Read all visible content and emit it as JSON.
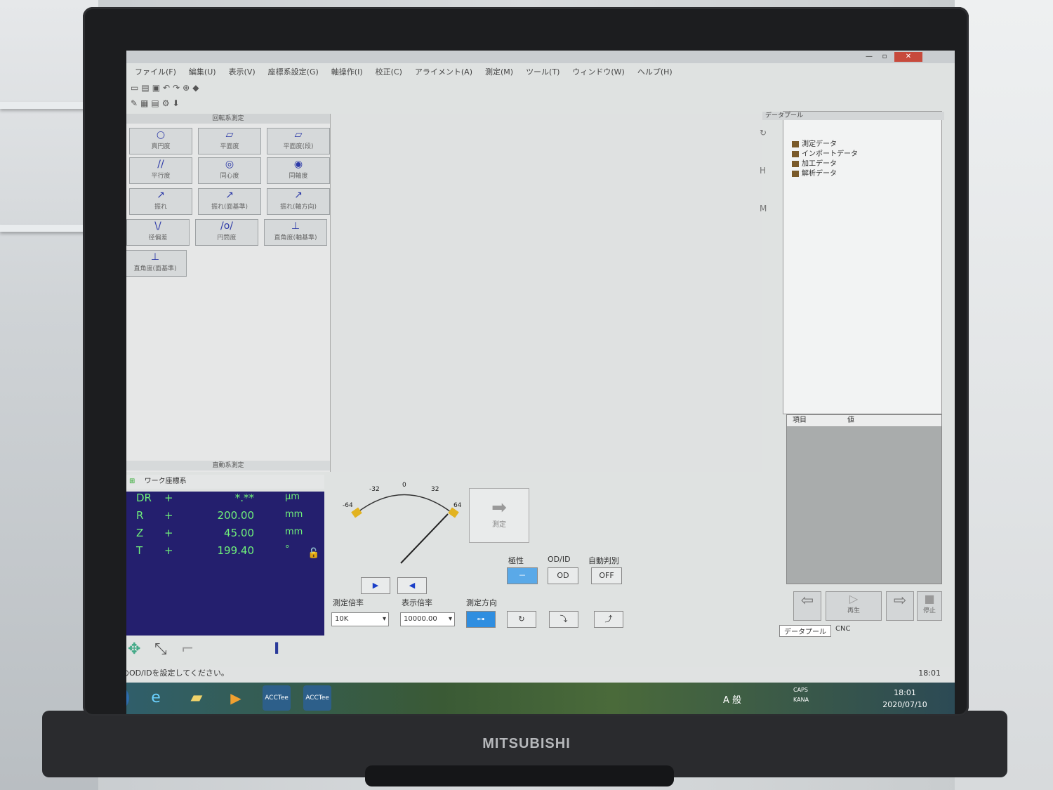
{
  "window": {
    "min": "—",
    "max": "▫",
    "close": "✕"
  },
  "menu": [
    "ファイル(F)",
    "編集(U)",
    "表示(V)",
    "座標系設定(G)",
    "軸操作(I)",
    "校正(C)",
    "アライメント(A)",
    "測定(M)",
    "ツール(T)",
    "ウィンドウ(W)",
    "ヘルプ(H)"
  ],
  "left_panel": {
    "header": "回転系測定",
    "footer": "直動系測定",
    "buttons": [
      {
        "icon": "○",
        "label": "真円度"
      },
      {
        "icon": "▱",
        "label": "平面度"
      },
      {
        "icon": "▱",
        "label": "平面度(段)"
      },
      {
        "icon": "//",
        "label": "平行度"
      },
      {
        "icon": "◎",
        "label": "同心度"
      },
      {
        "icon": "◉",
        "label": "同軸度"
      },
      {
        "icon": "↗",
        "label": "振れ"
      },
      {
        "icon": "↗",
        "label": "振れ(面基準)"
      },
      {
        "icon": "↗",
        "label": "振れ(軸方向)"
      },
      {
        "icon": "\\/",
        "label": "径偏差"
      },
      {
        "icon": "/o/",
        "label": "円筒度"
      },
      {
        "icon": "⊥",
        "label": "直角度(軸基準)"
      },
      {
        "icon": "⊥",
        "label": "直角度(面基準)"
      }
    ]
  },
  "readout": {
    "header": "ワーク座標系",
    "rows": [
      {
        "axis": "DR",
        "sign": "+",
        "value": "*.**",
        "unit": "μm"
      },
      {
        "axis": "R",
        "sign": "+",
        "value": "200.00",
        "unit": "mm"
      },
      {
        "axis": "Z",
        "sign": "+",
        "value": "45.00",
        "unit": "mm"
      },
      {
        "axis": "T",
        "sign": "+",
        "value": "199.40",
        "unit": "°"
      }
    ]
  },
  "meter": {
    "ticks": [
      "-64",
      "-32",
      "0",
      "32",
      "64"
    ]
  },
  "measure_button": "測定",
  "controls": {
    "polarity_label": "極性",
    "polarity_value": "－",
    "odid_label": "OD/ID",
    "odid_value": "OD",
    "auto_label": "自動判別",
    "auto_value": "OFF",
    "mag_label": "測定倍率",
    "mag_value": "10K",
    "disp_label": "表示倍率",
    "disp_value": "10000.00",
    "dir_label": "測定方向"
  },
  "datapool": {
    "title": "データプール",
    "tree": [
      "測定データ",
      "インポートデータ",
      "加工データ",
      "解析データ"
    ],
    "col_item": "項目",
    "col_value": "値",
    "nav_play": "再生",
    "nav_stop": "停止",
    "tab_datapool": "データプール",
    "tab_cnc": "CNC"
  },
  "status": {
    "message": "検出器のOD/IDを設定してください。",
    "time": "18:01"
  },
  "taskbar": {
    "app1": "ACCTee",
    "app2": "ACCTee",
    "ime": "A 般",
    "time": "18:01",
    "date": "2020/07/10",
    "caps": "CAPS",
    "kana": "KANA"
  },
  "brand": "MITSUBISHI"
}
